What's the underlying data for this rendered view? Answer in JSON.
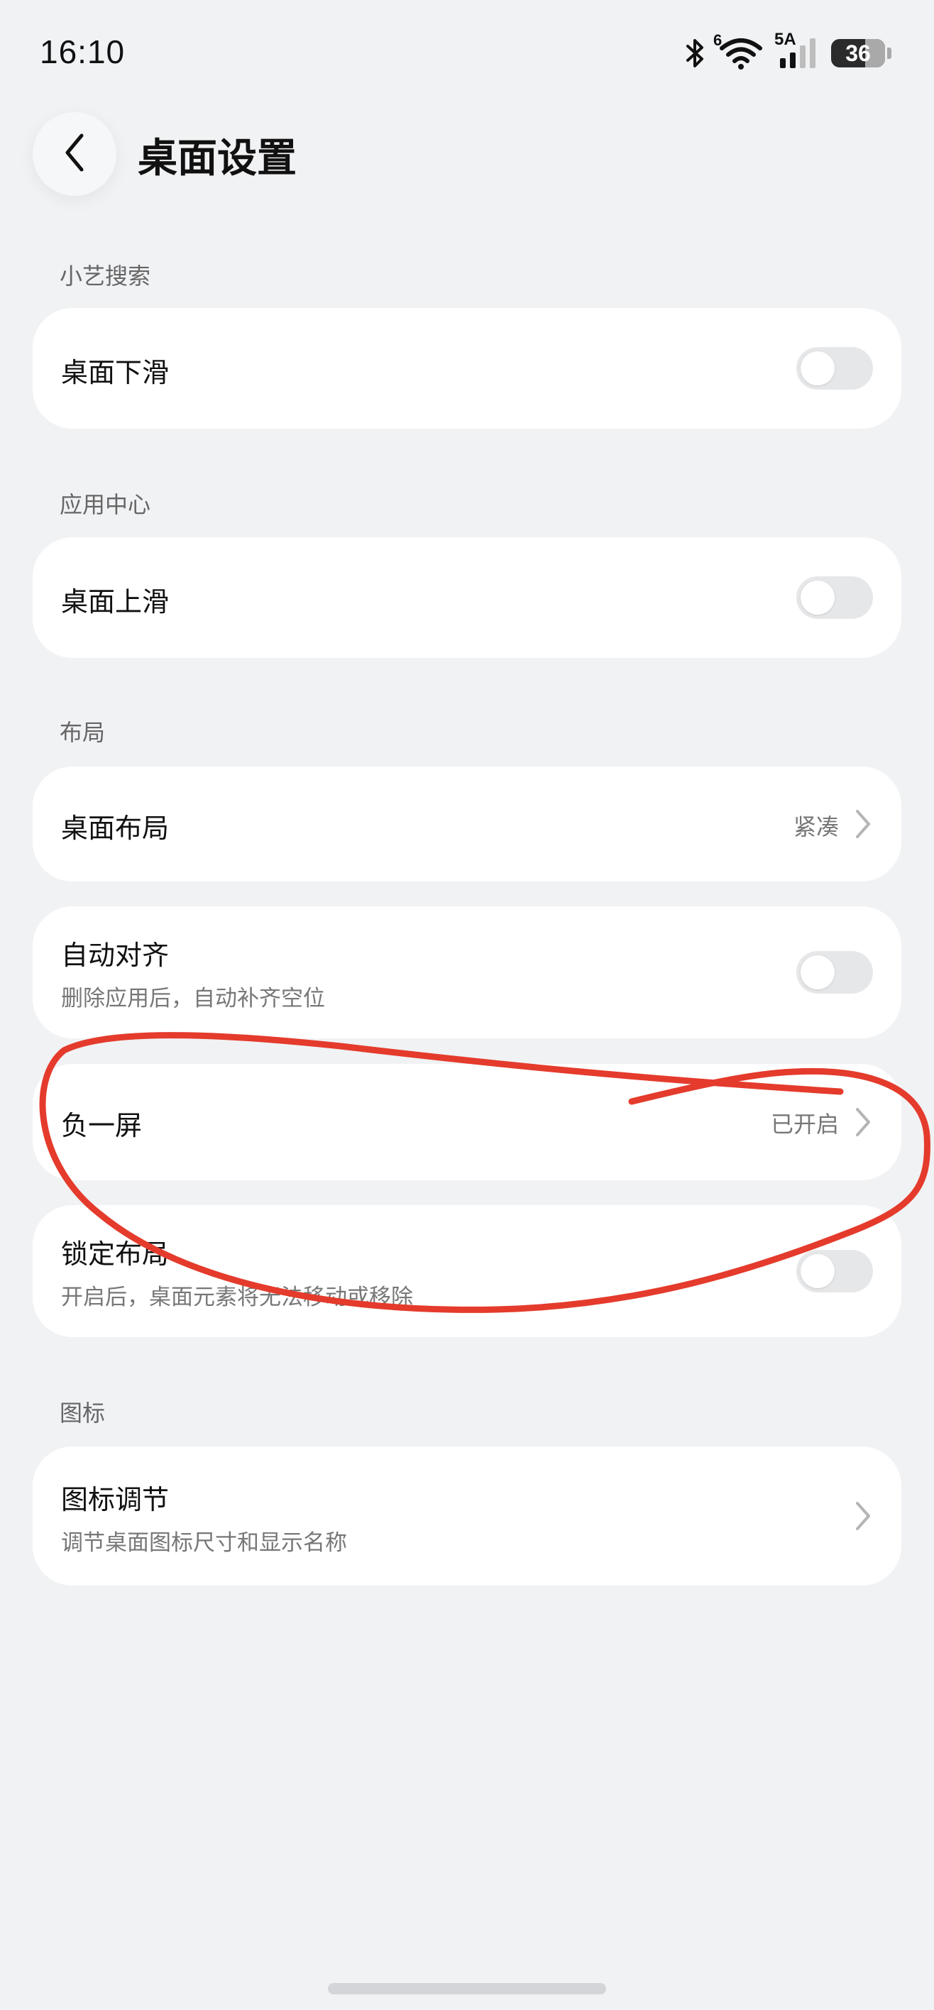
{
  "status_bar": {
    "time": "16:10",
    "wifi_badge": "6",
    "signal_label": "5A",
    "battery": "36"
  },
  "header": {
    "title": "桌面设置"
  },
  "sections": {
    "xiaoyi": {
      "header": "小艺搜索",
      "row_title": "桌面下滑",
      "toggle_on": false
    },
    "app_center": {
      "header": "应用中心",
      "row_title": "桌面上滑",
      "toggle_on": false
    },
    "layout": {
      "header": "布局",
      "desktop_layout": {
        "title": "桌面布局",
        "value": "紧凑"
      },
      "auto_align": {
        "title": "自动对齐",
        "subtitle": "删除应用后，自动补齐空位",
        "toggle_on": false
      },
      "minus_one_screen": {
        "title": "负一屏",
        "value": "已开启"
      },
      "lock_layout": {
        "title": "锁定布局",
        "subtitle": "开启后，桌面元素将无法移动或移除",
        "toggle_on": false
      }
    },
    "icons": {
      "header": "图标",
      "icon_adjust": {
        "title": "图标调节",
        "subtitle": "调节桌面图标尺寸和显示名称"
      }
    }
  },
  "colors": {
    "background": "#f1f2f4",
    "card": "#ffffff",
    "annotation_stroke": "#e43b2c",
    "toggle_off": "#e6e7e9"
  },
  "icons": [
    "bluetooth-icon",
    "wifi-icon",
    "signal-icon",
    "battery-icon",
    "back-arrow-icon",
    "chevron-right-icon"
  ]
}
